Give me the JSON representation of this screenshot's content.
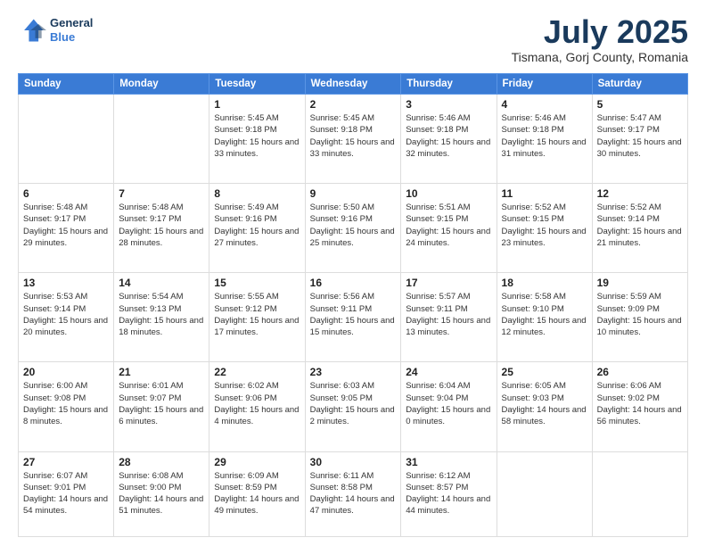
{
  "header": {
    "logo_line1": "General",
    "logo_line2": "Blue",
    "month": "July 2025",
    "location": "Tismana, Gorj County, Romania"
  },
  "weekdays": [
    "Sunday",
    "Monday",
    "Tuesday",
    "Wednesday",
    "Thursday",
    "Friday",
    "Saturday"
  ],
  "weeks": [
    [
      {
        "num": "",
        "sunrise": "",
        "sunset": "",
        "daylight": "",
        "empty": true
      },
      {
        "num": "",
        "sunrise": "",
        "sunset": "",
        "daylight": "",
        "empty": true
      },
      {
        "num": "1",
        "sunrise": "Sunrise: 5:45 AM",
        "sunset": "Sunset: 9:18 PM",
        "daylight": "Daylight: 15 hours and 33 minutes."
      },
      {
        "num": "2",
        "sunrise": "Sunrise: 5:45 AM",
        "sunset": "Sunset: 9:18 PM",
        "daylight": "Daylight: 15 hours and 33 minutes."
      },
      {
        "num": "3",
        "sunrise": "Sunrise: 5:46 AM",
        "sunset": "Sunset: 9:18 PM",
        "daylight": "Daylight: 15 hours and 32 minutes."
      },
      {
        "num": "4",
        "sunrise": "Sunrise: 5:46 AM",
        "sunset": "Sunset: 9:18 PM",
        "daylight": "Daylight: 15 hours and 31 minutes."
      },
      {
        "num": "5",
        "sunrise": "Sunrise: 5:47 AM",
        "sunset": "Sunset: 9:17 PM",
        "daylight": "Daylight: 15 hours and 30 minutes."
      }
    ],
    [
      {
        "num": "6",
        "sunrise": "Sunrise: 5:48 AM",
        "sunset": "Sunset: 9:17 PM",
        "daylight": "Daylight: 15 hours and 29 minutes."
      },
      {
        "num": "7",
        "sunrise": "Sunrise: 5:48 AM",
        "sunset": "Sunset: 9:17 PM",
        "daylight": "Daylight: 15 hours and 28 minutes."
      },
      {
        "num": "8",
        "sunrise": "Sunrise: 5:49 AM",
        "sunset": "Sunset: 9:16 PM",
        "daylight": "Daylight: 15 hours and 27 minutes."
      },
      {
        "num": "9",
        "sunrise": "Sunrise: 5:50 AM",
        "sunset": "Sunset: 9:16 PM",
        "daylight": "Daylight: 15 hours and 25 minutes."
      },
      {
        "num": "10",
        "sunrise": "Sunrise: 5:51 AM",
        "sunset": "Sunset: 9:15 PM",
        "daylight": "Daylight: 15 hours and 24 minutes."
      },
      {
        "num": "11",
        "sunrise": "Sunrise: 5:52 AM",
        "sunset": "Sunset: 9:15 PM",
        "daylight": "Daylight: 15 hours and 23 minutes."
      },
      {
        "num": "12",
        "sunrise": "Sunrise: 5:52 AM",
        "sunset": "Sunset: 9:14 PM",
        "daylight": "Daylight: 15 hours and 21 minutes."
      }
    ],
    [
      {
        "num": "13",
        "sunrise": "Sunrise: 5:53 AM",
        "sunset": "Sunset: 9:14 PM",
        "daylight": "Daylight: 15 hours and 20 minutes."
      },
      {
        "num": "14",
        "sunrise": "Sunrise: 5:54 AM",
        "sunset": "Sunset: 9:13 PM",
        "daylight": "Daylight: 15 hours and 18 minutes."
      },
      {
        "num": "15",
        "sunrise": "Sunrise: 5:55 AM",
        "sunset": "Sunset: 9:12 PM",
        "daylight": "Daylight: 15 hours and 17 minutes."
      },
      {
        "num": "16",
        "sunrise": "Sunrise: 5:56 AM",
        "sunset": "Sunset: 9:11 PM",
        "daylight": "Daylight: 15 hours and 15 minutes."
      },
      {
        "num": "17",
        "sunrise": "Sunrise: 5:57 AM",
        "sunset": "Sunset: 9:11 PM",
        "daylight": "Daylight: 15 hours and 13 minutes."
      },
      {
        "num": "18",
        "sunrise": "Sunrise: 5:58 AM",
        "sunset": "Sunset: 9:10 PM",
        "daylight": "Daylight: 15 hours and 12 minutes."
      },
      {
        "num": "19",
        "sunrise": "Sunrise: 5:59 AM",
        "sunset": "Sunset: 9:09 PM",
        "daylight": "Daylight: 15 hours and 10 minutes."
      }
    ],
    [
      {
        "num": "20",
        "sunrise": "Sunrise: 6:00 AM",
        "sunset": "Sunset: 9:08 PM",
        "daylight": "Daylight: 15 hours and 8 minutes."
      },
      {
        "num": "21",
        "sunrise": "Sunrise: 6:01 AM",
        "sunset": "Sunset: 9:07 PM",
        "daylight": "Daylight: 15 hours and 6 minutes."
      },
      {
        "num": "22",
        "sunrise": "Sunrise: 6:02 AM",
        "sunset": "Sunset: 9:06 PM",
        "daylight": "Daylight: 15 hours and 4 minutes."
      },
      {
        "num": "23",
        "sunrise": "Sunrise: 6:03 AM",
        "sunset": "Sunset: 9:05 PM",
        "daylight": "Daylight: 15 hours and 2 minutes."
      },
      {
        "num": "24",
        "sunrise": "Sunrise: 6:04 AM",
        "sunset": "Sunset: 9:04 PM",
        "daylight": "Daylight: 15 hours and 0 minutes."
      },
      {
        "num": "25",
        "sunrise": "Sunrise: 6:05 AM",
        "sunset": "Sunset: 9:03 PM",
        "daylight": "Daylight: 14 hours and 58 minutes."
      },
      {
        "num": "26",
        "sunrise": "Sunrise: 6:06 AM",
        "sunset": "Sunset: 9:02 PM",
        "daylight": "Daylight: 14 hours and 56 minutes."
      }
    ],
    [
      {
        "num": "27",
        "sunrise": "Sunrise: 6:07 AM",
        "sunset": "Sunset: 9:01 PM",
        "daylight": "Daylight: 14 hours and 54 minutes."
      },
      {
        "num": "28",
        "sunrise": "Sunrise: 6:08 AM",
        "sunset": "Sunset: 9:00 PM",
        "daylight": "Daylight: 14 hours and 51 minutes."
      },
      {
        "num": "29",
        "sunrise": "Sunrise: 6:09 AM",
        "sunset": "Sunset: 8:59 PM",
        "daylight": "Daylight: 14 hours and 49 minutes."
      },
      {
        "num": "30",
        "sunrise": "Sunrise: 6:11 AM",
        "sunset": "Sunset: 8:58 PM",
        "daylight": "Daylight: 14 hours and 47 minutes."
      },
      {
        "num": "31",
        "sunrise": "Sunrise: 6:12 AM",
        "sunset": "Sunset: 8:57 PM",
        "daylight": "Daylight: 14 hours and 44 minutes."
      },
      {
        "num": "",
        "sunrise": "",
        "sunset": "",
        "daylight": "",
        "empty": true
      },
      {
        "num": "",
        "sunrise": "",
        "sunset": "",
        "daylight": "",
        "empty": true
      }
    ]
  ]
}
